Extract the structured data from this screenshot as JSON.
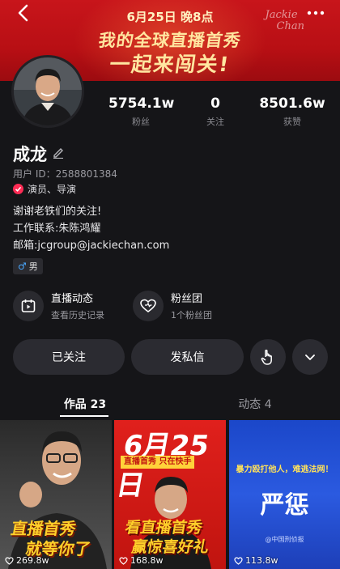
{
  "banner": {
    "date": "6月25日 晚8点",
    "line1": "我的全球直播首秀",
    "line2": "一起来闯关!",
    "signature_line1": "Jackie",
    "signature_line2": "Chan"
  },
  "stats": [
    {
      "value": "5754.1w",
      "label": "粉丝"
    },
    {
      "value": "0",
      "label": "关注"
    },
    {
      "value": "8501.6w",
      "label": "获赞"
    }
  ],
  "profile": {
    "name": "成龙",
    "user_id": "用户 ID：2588801384",
    "certification": "演员、导演",
    "bio": [
      "谢谢老铁们的关注!",
      "工作联系:朱陈鸿耀",
      "邮箱:jcgroup@jackiechan.com"
    ],
    "gender": "男"
  },
  "features": [
    {
      "title": "直播动态",
      "subtitle": "查看历史记录",
      "icon": "live-calendar-icon"
    },
    {
      "title": "粉丝团",
      "subtitle": "1个粉丝团",
      "icon": "heart-outline-icon"
    }
  ],
  "actions": {
    "followed": "已关注",
    "message": "发私信",
    "gesture_icon": "hand-pointer-icon",
    "more_icon": "chevron-down-icon"
  },
  "tabs": [
    {
      "label": "作品 23",
      "active": true
    },
    {
      "label": "动态 4",
      "active": false
    }
  ],
  "videos": [
    {
      "likes": "269.8w",
      "caption_line1": "直播首秀",
      "caption_line2": "就等你了"
    },
    {
      "likes": "168.8w",
      "title": "6月25日",
      "banner": "直播首秀 只在快手",
      "caption_line1": "看直播首秀",
      "caption_line2": "赢惊喜好礼"
    },
    {
      "likes": "113.8w",
      "top_text": "暴力殴打他人，难逃法网！",
      "title": "严惩",
      "source": "@中国刑侦报"
    }
  ],
  "colors": {
    "banner_red": "#c8151b",
    "accent_pink": "#fe2c55",
    "background": "#151518"
  }
}
